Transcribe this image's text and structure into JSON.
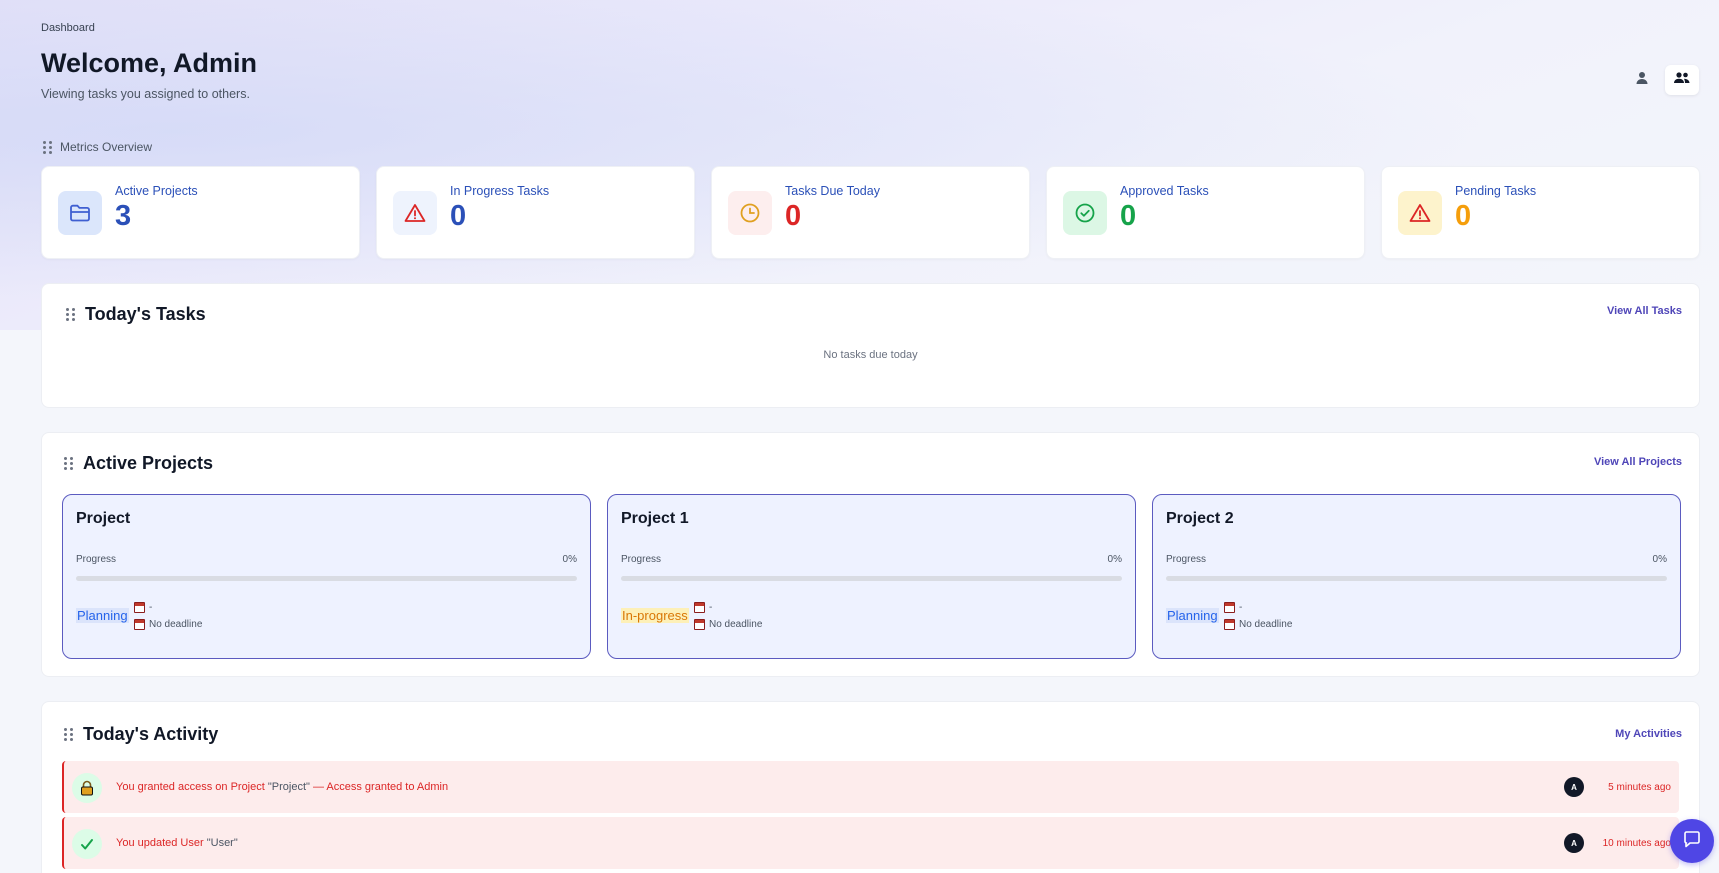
{
  "header": {
    "breadcrumb": "Dashboard",
    "title": "Welcome, Admin",
    "subtitle": "Viewing tasks you assigned to others."
  },
  "view_toggle": {
    "options": [
      {
        "icon": "person-icon",
        "active": false
      },
      {
        "icon": "people-icon",
        "active": true
      }
    ]
  },
  "metrics": {
    "label": "Metrics Overview",
    "items": [
      {
        "label": "Active Projects",
        "value": "3",
        "icon": "folder-icon",
        "color": "#2b50b8",
        "bg": "#dbe6fb"
      },
      {
        "label": "In Progress Tasks",
        "value": "0",
        "icon": "warning-icon",
        "color": "#2b50b8",
        "bg": "#eef3fd"
      },
      {
        "label": "Tasks Due Today",
        "value": "0",
        "icon": "clock-icon",
        "color": "#dc2626",
        "bg": "#fdeeee"
      },
      {
        "label": "Approved Tasks",
        "value": "0",
        "icon": "check-circle-icon",
        "color": "#16a34a",
        "bg": "#dcf7e5"
      },
      {
        "label": "Pending Tasks",
        "value": "0",
        "icon": "warning-icon",
        "color": "#f59e0b",
        "bg": "#fdf3cc"
      }
    ]
  },
  "todays_tasks": {
    "title": "Today's Tasks",
    "link": "View All Tasks",
    "empty": "No tasks due today"
  },
  "active_projects": {
    "title": "Active Projects",
    "link": "View All Projects",
    "progress_label": "Progress",
    "projects": [
      {
        "name": "Project",
        "progress": "0%",
        "status": "Planning",
        "start": "-",
        "deadline": "No deadline"
      },
      {
        "name": "Project 1",
        "progress": "0%",
        "status": "In-progress",
        "start": "-",
        "deadline": "No deadline"
      },
      {
        "name": "Project 2",
        "progress": "0%",
        "status": "Planning",
        "start": "-",
        "deadline": "No deadline"
      }
    ]
  },
  "todays_activity": {
    "title": "Today's Activity",
    "link": "My Activities",
    "items": [
      {
        "icon": "lock-icon",
        "text": "You granted access on Project ",
        "quote": "\"Project\"",
        "suffix": " — Access granted to Admin",
        "avatar": "A",
        "time": "5 minutes ago"
      },
      {
        "icon": "check-icon",
        "text": "You updated User ",
        "quote": "\"User\"",
        "suffix": "",
        "avatar": "A",
        "time": "10 minutes ago"
      }
    ]
  },
  "colors": {
    "accent": "#4f46e5",
    "danger": "#dc2626"
  }
}
